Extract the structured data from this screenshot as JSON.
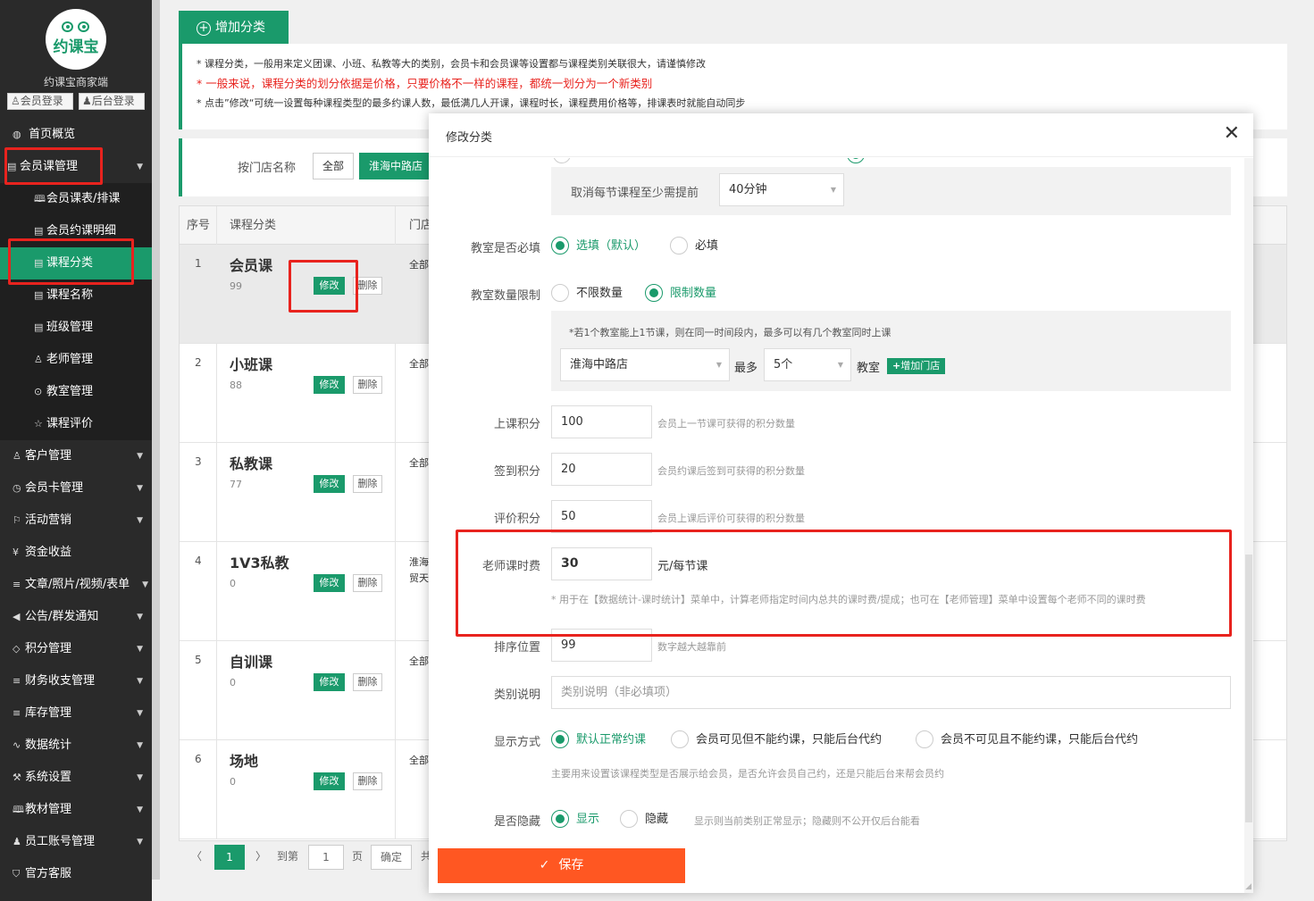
{
  "sidebar": {
    "logo_text": "约课宝",
    "brand": "约课宝商家端",
    "login_member": "会员登录",
    "login_admin": "后台登录",
    "items": [
      {
        "label": "首页概览",
        "icon": "globe-icon"
      },
      {
        "label": "会员课管理",
        "icon": "doc-icon"
      },
      {
        "label": "客户管理",
        "icon": "user-icon"
      },
      {
        "label": "会员卡管理",
        "icon": "clock-icon"
      },
      {
        "label": "活动营销",
        "icon": "flag-icon"
      },
      {
        "label": "资金收益",
        "icon": "yen-icon"
      },
      {
        "label": "文章/照片/视频/表单",
        "icon": "sliders-icon"
      },
      {
        "label": "公告/群发通知",
        "icon": "speaker-icon"
      },
      {
        "label": "积分管理",
        "icon": "diamond-icon"
      },
      {
        "label": "财务收支管理",
        "icon": "sliders-icon"
      },
      {
        "label": "库存管理",
        "icon": "sliders-icon"
      },
      {
        "label": "数据统计",
        "icon": "pulse-icon"
      },
      {
        "label": "系统设置",
        "icon": "tools-icon"
      },
      {
        "label": "教材管理",
        "icon": "book-icon"
      },
      {
        "label": "员工账号管理",
        "icon": "person-icon"
      },
      {
        "label": "官方客服",
        "icon": "shield-icon"
      }
    ],
    "sub_items": [
      {
        "label": "会员课表/排课",
        "icon": "book-icon"
      },
      {
        "label": "会员约课明细",
        "icon": "list-icon"
      },
      {
        "label": "课程分类",
        "icon": "doc-icon"
      },
      {
        "label": "课程名称",
        "icon": "doc-icon"
      },
      {
        "label": "班级管理",
        "icon": "doc-icon"
      },
      {
        "label": "老师管理",
        "icon": "user-icon"
      },
      {
        "label": "教室管理",
        "icon": "pin-icon"
      },
      {
        "label": "课程评价",
        "icon": "star-icon"
      }
    ]
  },
  "main": {
    "add_category": "增加分类",
    "notice": [
      "* 课程分类，一般用来定义团课、小班、私教等大的类别，会员卡和会员课等设置都与课程类别关联很大，请谨慎修改",
      "* 一般来说，课程分类的划分依据是价格，只要价格不一样的课程，都统一划分为一个新类别",
      "* 点击”修改“可统一设置每种课程类型的最多约课人数，最低满几人开课，课程时长，课程费用价格等，排课表时就能自动同步"
    ],
    "filter_label": "按门店名称",
    "filter_all": "全部",
    "filter_store": "淮海中路店",
    "columns": {
      "index": "序号",
      "category": "课程分类",
      "store": "门店"
    },
    "edit_label": "修改",
    "delete_label": "删除",
    "rows": [
      {
        "index": "1",
        "name": "会员课",
        "count": "99",
        "store": "全部"
      },
      {
        "index": "2",
        "name": "小班课",
        "count": "88",
        "store": "全部"
      },
      {
        "index": "3",
        "name": "私教课",
        "count": "77",
        "store": "全部"
      },
      {
        "index": "4",
        "name": "1V3私教",
        "count": "0",
        "store": "淮海\n贸天"
      },
      {
        "index": "5",
        "name": "自训课",
        "count": "0",
        "store": "全部"
      },
      {
        "index": "6",
        "name": "场地",
        "count": "0",
        "store": "全部"
      }
    ],
    "pager": {
      "current": "1",
      "goto": "到第",
      "page_input": "1",
      "page_unit": "页",
      "confirm": "确定",
      "total_prefix": "共"
    }
  },
  "modal": {
    "title": "修改分类",
    "cancel_advance_label": "取消每节课程至少需提前",
    "cancel_advance_value": "40分钟",
    "classroom_required": {
      "label": "教室是否必填",
      "opt1": "选填（默认）",
      "opt2": "必填",
      "selected": 1
    },
    "classroom_limit": {
      "label": "教室数量限制",
      "opt1": "不限数量",
      "opt2": "限制数量",
      "selected": 2,
      "hint": "*若1个教室能上1节课，则在同一时间段内，最多可以有几个教室同时上课",
      "store": "淮海中路店",
      "max_label": "最多",
      "max_value": "5个",
      "unit": "教室",
      "add_store": "增加门店"
    },
    "class_points": {
      "label": "上课积分",
      "value": "100",
      "hint": "会员上一节课可获得的积分数量"
    },
    "checkin_points": {
      "label": "签到积分",
      "value": "20",
      "hint": "会员约课后签到可获得的积分数量"
    },
    "review_points": {
      "label": "评价积分",
      "value": "50",
      "hint": "会员上课后评价可获得的积分数量"
    },
    "teacher_fee": {
      "label": "老师课时费",
      "value": "30",
      "unit": "元/每节课",
      "hint": "* 用于在【数据统计-课时统计】菜单中，计算老师指定时间内总共的课时费/提成；也可在【老师管理】菜单中设置每个老师不同的课时费"
    },
    "sort": {
      "label": "排序位置",
      "value": "99",
      "hint": "数字越大越靠前"
    },
    "desc": {
      "label": "类别说明",
      "placeholder": "类别说明（非必填项）"
    },
    "display": {
      "label": "显示方式",
      "opt1": "默认正常约课",
      "opt2": "会员可见但不能约课，只能后台代约",
      "opt3": "会员不可见且不能约课，只能后台代约",
      "selected": 1,
      "hint": "主要用来设置该课程类型是否展示给会员，是否允许会员自己约，还是只能后台来帮会员约"
    },
    "hidden": {
      "label": "是否隐藏",
      "opt1": "显示",
      "opt2": "隐藏",
      "selected": 1,
      "hint": "显示则当前类别正常显示；隐藏则不公开仅后台能看"
    },
    "save": "保存"
  },
  "colors": {
    "accent": "#1a9a6b",
    "save": "#ff5722",
    "highlight": "#e8231e",
    "sidebar": "#2a2a2a"
  }
}
